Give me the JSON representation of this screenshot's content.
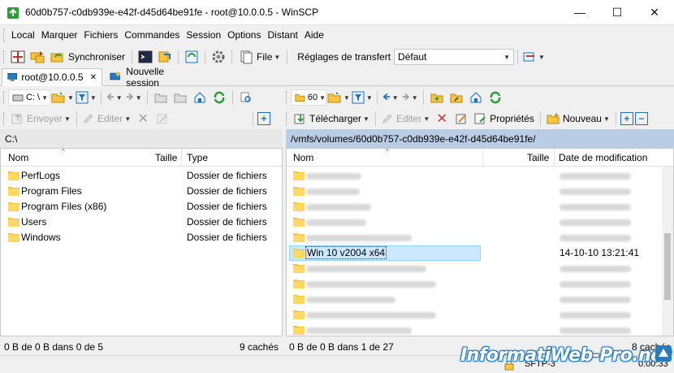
{
  "window": {
    "title": "60d0b757-c0db939e-e42f-d45d64be91fe - root@10.0.0.5 - WinSCP",
    "minimize_glyph": "—",
    "maximize_glyph": "☐",
    "close_glyph": "✕"
  },
  "menu": [
    "Local",
    "Marquer",
    "Fichiers",
    "Commandes",
    "Session",
    "Options",
    "Distant",
    "Aide"
  ],
  "main_toolbar": {
    "synchronize_label": "Synchroniser",
    "file_label": "File",
    "transfer_settings_label": "Réglages de transfert",
    "transfer_settings_value": "Défaut"
  },
  "tabs": {
    "session": "root@10.0.0.5",
    "close_glyph": "✕",
    "new_session": "Nouvelle session"
  },
  "left_panel": {
    "drive_value": "C: \\",
    "upload_label": "Envoyer",
    "edit_label": "Editer",
    "path": "C:\\",
    "columns": [
      "Nom",
      "Taille",
      "Type"
    ],
    "items": [
      {
        "name": "PerfLogs",
        "size": "",
        "type": "Dossier de fichiers"
      },
      {
        "name": "Program Files",
        "size": "",
        "type": "Dossier de fichiers"
      },
      {
        "name": "Program Files (x86)",
        "size": "",
        "type": "Dossier de fichiers"
      },
      {
        "name": "Users",
        "size": "",
        "type": "Dossier de fichiers"
      },
      {
        "name": "Windows",
        "size": "",
        "type": "Dossier de fichiers"
      }
    ],
    "status_left": "0 B de 0 B dans 0 de 5",
    "status_right": "9 cachés"
  },
  "right_panel": {
    "drive_value": "60",
    "download_label": "Télécharger",
    "edit_label": "Editer",
    "properties_label": "Propriétés",
    "new_label": "Nouveau",
    "path": "/vmfs/volumes/60d0b757-c0db939e-e42f-d45d64be91fe/",
    "columns": [
      "Nom",
      "Taille",
      "Date de modification"
    ],
    "selected_item": {
      "name": "Win 10 v2004 x64",
      "date": "14-10-10 13:21:41"
    },
    "status_left": "0 B de 0 B dans 1 de 27",
    "status_right": "8 cachés"
  },
  "bottom_status": {
    "protocol": "SFTP-3",
    "time": "0:00:33"
  },
  "watermark": "InformatiWeb-Pro.net",
  "colors": {
    "folder": "#f5c542",
    "selection": "#cce8ff",
    "selection_border": "#99d1ff",
    "path_left_bg": "#e8e8e8",
    "path_right_bg": "#b9cde5",
    "accent_blue": "#1f6fc5",
    "green": "#2e9b3a",
    "red": "#d0312d"
  }
}
